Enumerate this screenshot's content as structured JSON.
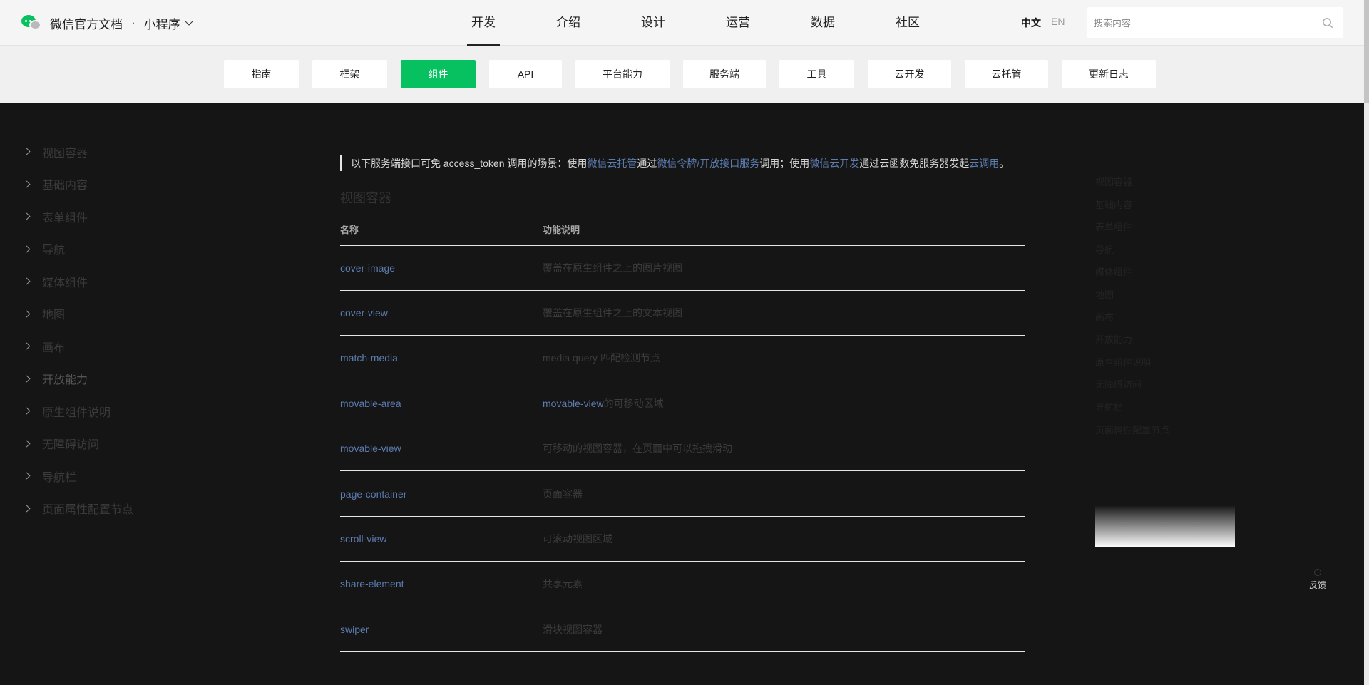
{
  "header": {
    "brand_name": "微信官方文档",
    "separator": "·",
    "product": "小程序",
    "nav": [
      "开发",
      "介绍",
      "设计",
      "运营",
      "数据",
      "社区"
    ],
    "active_nav": "开发",
    "lang_zh": "中文",
    "lang_en": "EN",
    "search_placeholder": "搜索内容"
  },
  "subnav": {
    "tabs": [
      "指南",
      "框架",
      "组件",
      "API",
      "平台能力",
      "服务端",
      "工具",
      "云开发",
      "云托管",
      "更新日志"
    ],
    "active": "组件"
  },
  "sidebar": {
    "items": [
      "视图容器",
      "基础内容",
      "表单组件",
      "导航",
      "媒体组件",
      "地图",
      "画布",
      "开放能力",
      "原生组件说明",
      "无障碍访问",
      "导航栏",
      "页面属性配置节点"
    ]
  },
  "content": {
    "notice": {
      "t1": "以下服务端接口可免 access_token 调用的场景：使用",
      "l1": "微信云托管",
      "t2": "通过",
      "l2": "微信令牌/开放接口服务",
      "t3": "调用；使用",
      "l3": "微信云开发",
      "t4": "通过云函数免服务器发起",
      "l4": "云调用",
      "t5": "。"
    },
    "section_title": "视图容器",
    "table": {
      "headers": [
        "名称",
        "功能说明"
      ],
      "rows": [
        {
          "name": "cover-image",
          "desc": "覆盖在原生组件之上的图片视图"
        },
        {
          "name": "cover-view",
          "desc": "覆盖在原生组件之上的文本视图"
        },
        {
          "name": "match-media",
          "desc": "media query 匹配检测节点"
        },
        {
          "name": "movable-area",
          "desc_link": "movable-view",
          "desc": "的可移动区域"
        },
        {
          "name": "movable-view",
          "desc": "可移动的视图容器，在页面中可以拖拽滑动"
        },
        {
          "name": "page-container",
          "desc": "页面容器"
        },
        {
          "name": "scroll-view",
          "desc": "可滚动视图区域"
        },
        {
          "name": "share-element",
          "desc": "共享元素"
        },
        {
          "name": "swiper",
          "desc": "滑块视图容器"
        }
      ]
    }
  },
  "toc": {
    "items": [
      "视图容器",
      "基础内容",
      "表单组件",
      "导航",
      "媒体组件",
      "地图",
      "画布",
      "开放能力",
      "原生组件说明",
      "无障碍访问",
      "导航栏",
      "页面属性配置节点"
    ]
  },
  "feedback": {
    "label": "反馈"
  },
  "colors": {
    "accent": "#07c160",
    "link": "#5d7cb0",
    "background": "#151515"
  }
}
